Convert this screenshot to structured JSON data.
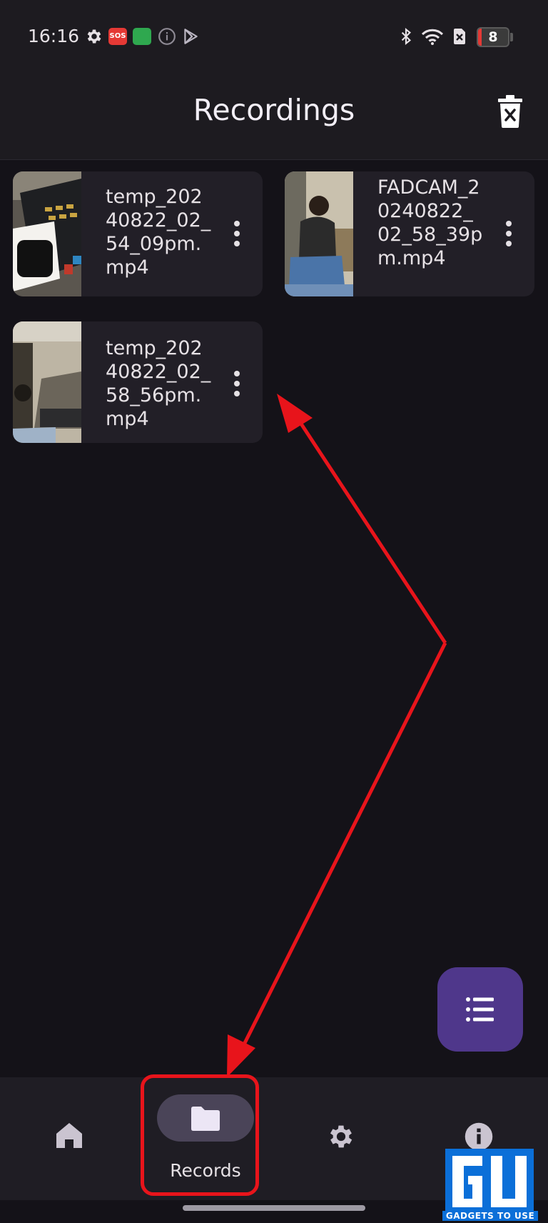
{
  "status_bar": {
    "time": "16:16",
    "sos_label": "SOS",
    "battery_level": "8",
    "icons": [
      "gear-icon",
      "sos-icon",
      "app-store-icon",
      "info-icon",
      "play-store-icon",
      "bluetooth-icon",
      "wifi-icon",
      "no-sim-icon",
      "battery-icon"
    ]
  },
  "app_bar": {
    "title": "Recordings",
    "delete_all_icon": "trash-icon"
  },
  "recordings": [
    {
      "name": "temp_20240822_02_54_09pm.mp4"
    },
    {
      "name": "FADCAM_20240822_02_58_39pm.mp4"
    },
    {
      "name": "temp_20240822_02_58_56pm.mp4"
    }
  ],
  "fab": {
    "icon": "list-icon"
  },
  "bottom_nav": {
    "items": [
      {
        "icon": "home-icon",
        "label": ""
      },
      {
        "icon": "folder-icon",
        "label": "Records",
        "selected": true
      },
      {
        "icon": "gear-icon",
        "label": ""
      },
      {
        "icon": "info-icon",
        "label": ""
      }
    ]
  },
  "watermark": {
    "text": "GADGETS TO USE"
  },
  "colors": {
    "background": "#141218",
    "surface": "#1d1b20",
    "card": "#221f27",
    "fab": "#4f378b",
    "nav_pill": "#4a4458",
    "annotation_red": "#e8141b"
  }
}
